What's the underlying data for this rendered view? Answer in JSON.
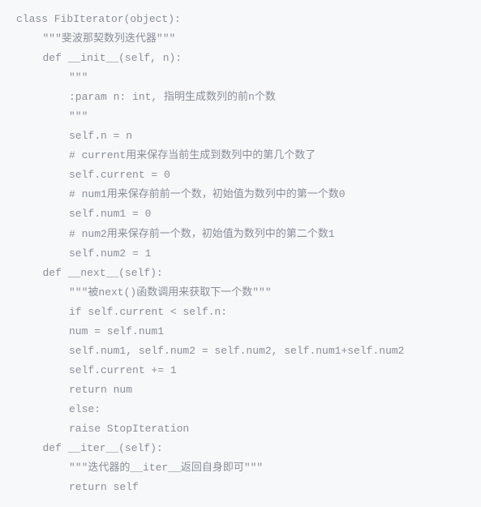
{
  "code": {
    "lines": [
      {
        "indent": 0,
        "text": "class FibIterator(object):"
      },
      {
        "indent": 1,
        "text": "\"\"\"斐波那契数列迭代器\"\"\""
      },
      {
        "indent": 1,
        "text": "def __init__(self, n):"
      },
      {
        "indent": 2,
        "text": "\"\"\""
      },
      {
        "indent": 2,
        "text": ":param n: int, 指明生成数列的前n个数"
      },
      {
        "indent": 2,
        "text": "\"\"\""
      },
      {
        "indent": 2,
        "text": "self.n = n"
      },
      {
        "indent": 2,
        "text": "# current用来保存当前生成到数列中的第几个数了"
      },
      {
        "indent": 2,
        "text": "self.current = 0"
      },
      {
        "indent": 2,
        "text": "# num1用来保存前前一个数，初始值为数列中的第一个数0"
      },
      {
        "indent": 2,
        "text": "self.num1 = 0"
      },
      {
        "indent": 2,
        "text": "# num2用来保存前一个数，初始值为数列中的第二个数1"
      },
      {
        "indent": 2,
        "text": "self.num2 = 1"
      },
      {
        "indent": 1,
        "text": "def __next__(self):"
      },
      {
        "indent": 2,
        "text": "\"\"\"被next()函数调用来获取下一个数\"\"\""
      },
      {
        "indent": 2,
        "text": "if self.current < self.n:"
      },
      {
        "indent": 2,
        "text": "num = self.num1"
      },
      {
        "indent": 2,
        "text": "self.num1, self.num2 = self.num2, self.num1+self.num2"
      },
      {
        "indent": 2,
        "text": "self.current += 1"
      },
      {
        "indent": 2,
        "text": "return num"
      },
      {
        "indent": 2,
        "text": "else:"
      },
      {
        "indent": 2,
        "text": "raise StopIteration"
      },
      {
        "indent": 1,
        "text": "def __iter__(self):"
      },
      {
        "indent": 1,
        "text": ""
      },
      {
        "indent": 2,
        "text": "\"\"\"迭代器的__iter__返回自身即可\"\"\""
      },
      {
        "indent": 2,
        "text": "return self"
      }
    ]
  }
}
